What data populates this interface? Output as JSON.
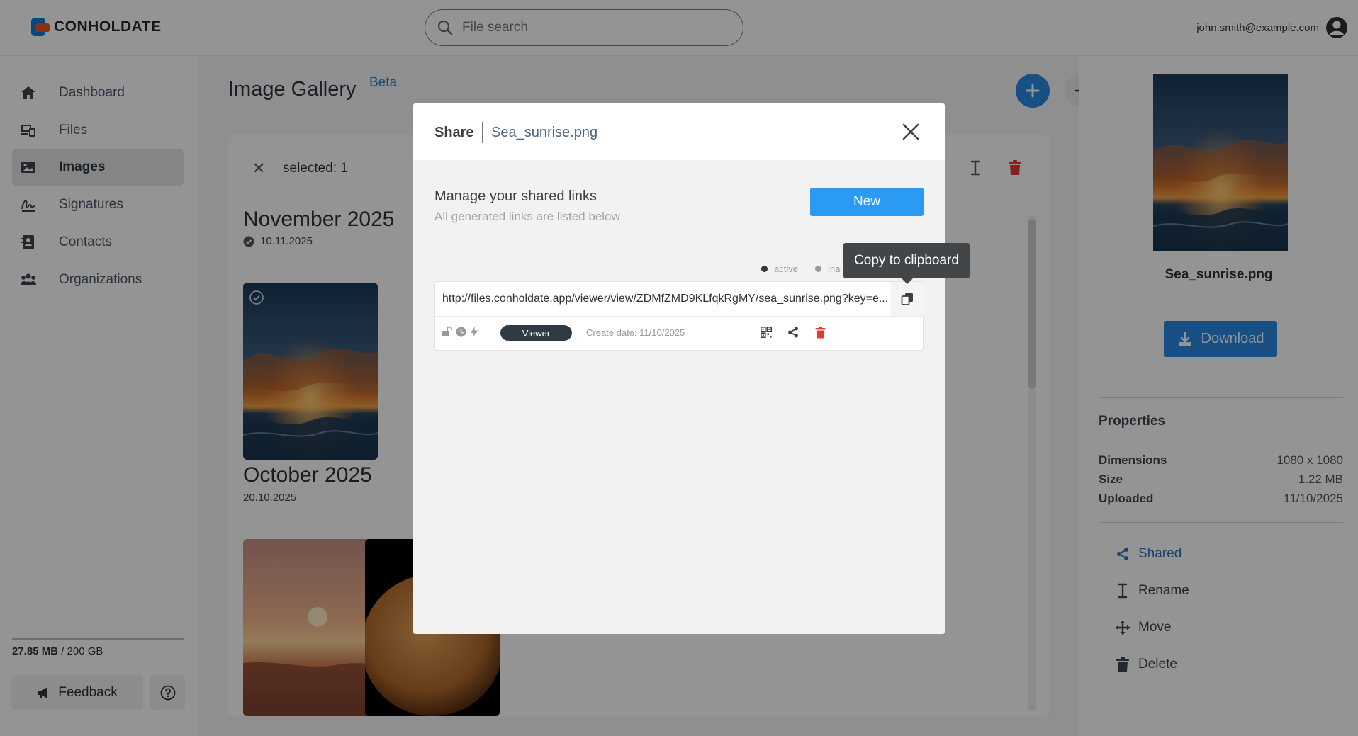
{
  "app": {
    "logo_text": "CONHOLDATE"
  },
  "search": {
    "placeholder": "File search"
  },
  "user": {
    "email": "john.smith@example.com"
  },
  "sidebar": {
    "items": [
      {
        "label": "Dashboard",
        "icon": "home-icon"
      },
      {
        "label": "Files",
        "icon": "files-icon"
      },
      {
        "label": "Images",
        "icon": "image-icon",
        "active": true
      },
      {
        "label": "Signatures",
        "icon": "signature-icon"
      },
      {
        "label": "Contacts",
        "icon": "contacts-icon"
      },
      {
        "label": "Organizations",
        "icon": "organizations-icon"
      }
    ],
    "storage_used": "27.85 MB",
    "storage_total": " / 200 GB",
    "feedback_label": "Feedback"
  },
  "gallery": {
    "title": "Image Gallery",
    "badge": "Beta",
    "selection_text": "selected: 1",
    "groups": [
      {
        "month": "November 2025",
        "date": "10.11.2025"
      },
      {
        "month": "October 2025",
        "date": "20.10.2025"
      }
    ]
  },
  "details": {
    "file_name": "Sea_sunrise.png",
    "download_label": "Download",
    "properties_title": "Properties",
    "properties": [
      {
        "key": "Dimensions",
        "value": "1080 x 1080"
      },
      {
        "key": "Size",
        "value": "1.22 MB"
      },
      {
        "key": "Uploaded",
        "value": "11/10/2025"
      }
    ],
    "actions": [
      {
        "label": "Shared",
        "icon": "share-icon"
      },
      {
        "label": "Rename",
        "icon": "rename-icon"
      },
      {
        "label": "Move",
        "icon": "move-icon"
      },
      {
        "label": "Delete",
        "icon": "trash-icon"
      }
    ]
  },
  "modal": {
    "title": "Share",
    "file_name": "Sea_sunrise.png",
    "manage_title": "Manage your shared links",
    "manage_subtitle": "All generated links are listed below",
    "new_label": "New",
    "legend_active": "active",
    "legend_inactive": "ina",
    "tooltip": "Copy to clipboard",
    "link": {
      "url": "http://files.conholdate.app/viewer/view/ZDMfZMD9KLfqkRgMY/sea_sunrise.png?key=e...",
      "role": "Viewer",
      "create_date": "Create date: 11/10/2025"
    }
  },
  "colors": {
    "accent": "#2a89e3",
    "danger": "#e53935",
    "overlay": "rgba(0,0,0,0.42)"
  }
}
